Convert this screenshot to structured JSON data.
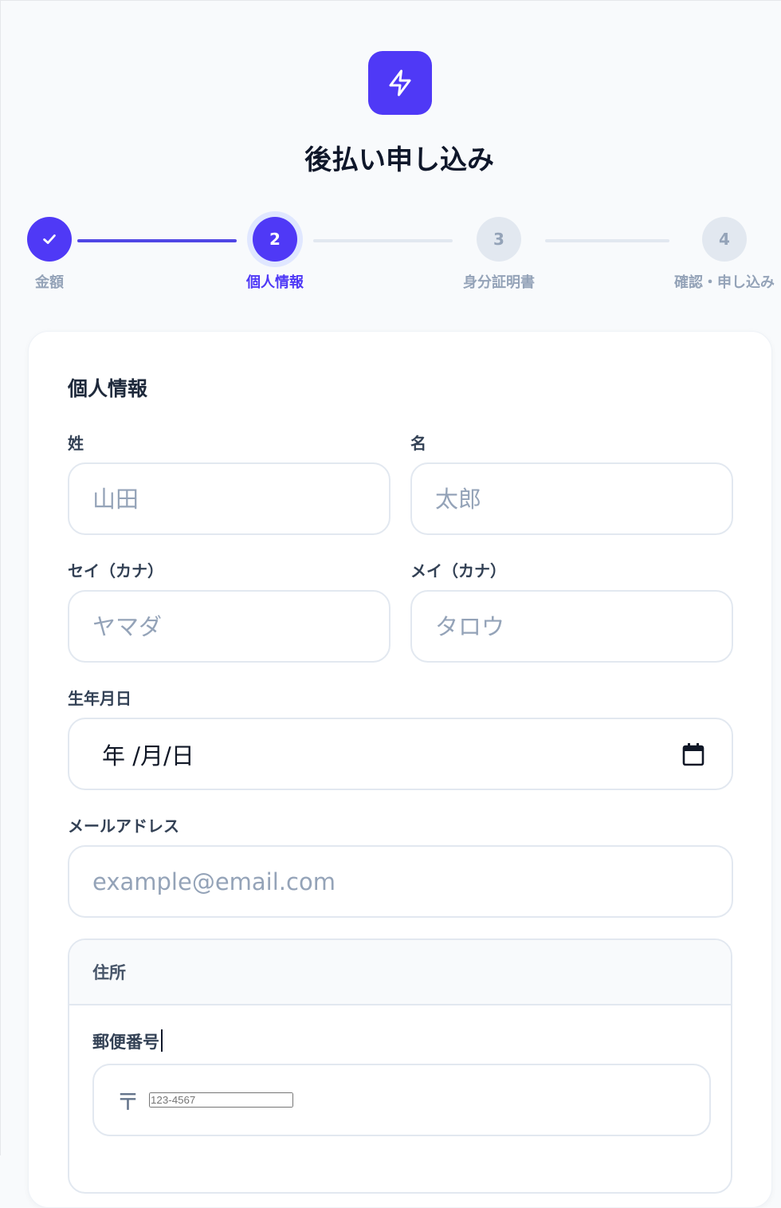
{
  "app": {
    "title": "後払い申し込み",
    "logo_icon": "lightning-bolt-icon",
    "accent_color": "#4f39f6"
  },
  "stepper": {
    "steps": [
      {
        "number": "",
        "label": "金額",
        "state": "done"
      },
      {
        "number": "2",
        "label": "個人情報",
        "state": "active"
      },
      {
        "number": "3",
        "label": "身分証明書",
        "state": "todo"
      },
      {
        "number": "4",
        "label": "確認・申し込み",
        "state": "todo"
      }
    ]
  },
  "form": {
    "section_title": "個人情報",
    "last_name": {
      "label": "姓",
      "placeholder": "山田",
      "value": ""
    },
    "first_name": {
      "label": "名",
      "placeholder": "太郎",
      "value": ""
    },
    "last_name_kana": {
      "label": "セイ（カナ）",
      "placeholder": "ヤマダ",
      "value": ""
    },
    "first_name_kana": {
      "label": "メイ（カナ）",
      "placeholder": "タロウ",
      "value": ""
    },
    "birthdate": {
      "label": "生年月日",
      "display": "年 /月/日"
    },
    "email": {
      "label": "メールアドレス",
      "placeholder": "example@email.com",
      "value": ""
    },
    "address": {
      "heading": "住所",
      "postal_code": {
        "label": "郵便番号",
        "prefix": "〒",
        "placeholder": "123-4567",
        "value": ""
      }
    }
  }
}
